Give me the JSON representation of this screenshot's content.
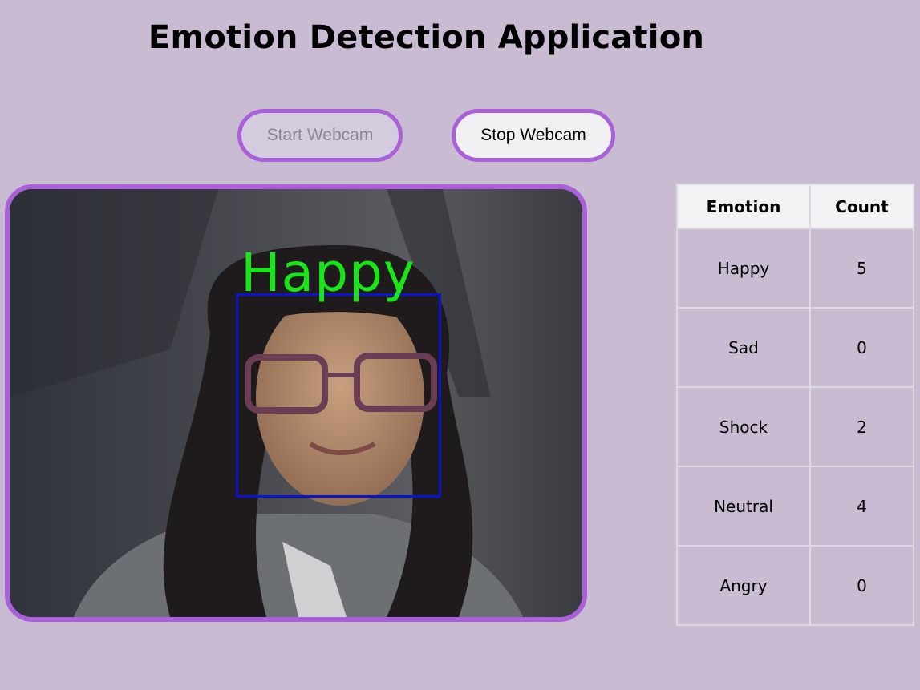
{
  "page": {
    "title": "Emotion Detection Application"
  },
  "controls": {
    "start_label": "Start Webcam",
    "start_disabled": true,
    "stop_label": "Stop Webcam"
  },
  "video": {
    "detected_emotion": "Happy"
  },
  "table": {
    "headers": [
      "Emotion",
      "Count"
    ],
    "rows": [
      {
        "emotion": "Happy",
        "count": "5"
      },
      {
        "emotion": "Sad",
        "count": "0"
      },
      {
        "emotion": "Shock",
        "count": "2"
      },
      {
        "emotion": "Neutral",
        "count": "4"
      },
      {
        "emotion": "Angry",
        "count": "0"
      }
    ]
  },
  "colors": {
    "background": "#c9bcd2",
    "accent_border": "#a960d8",
    "label_green": "#19e619",
    "face_box_blue": "#0a14c8"
  }
}
